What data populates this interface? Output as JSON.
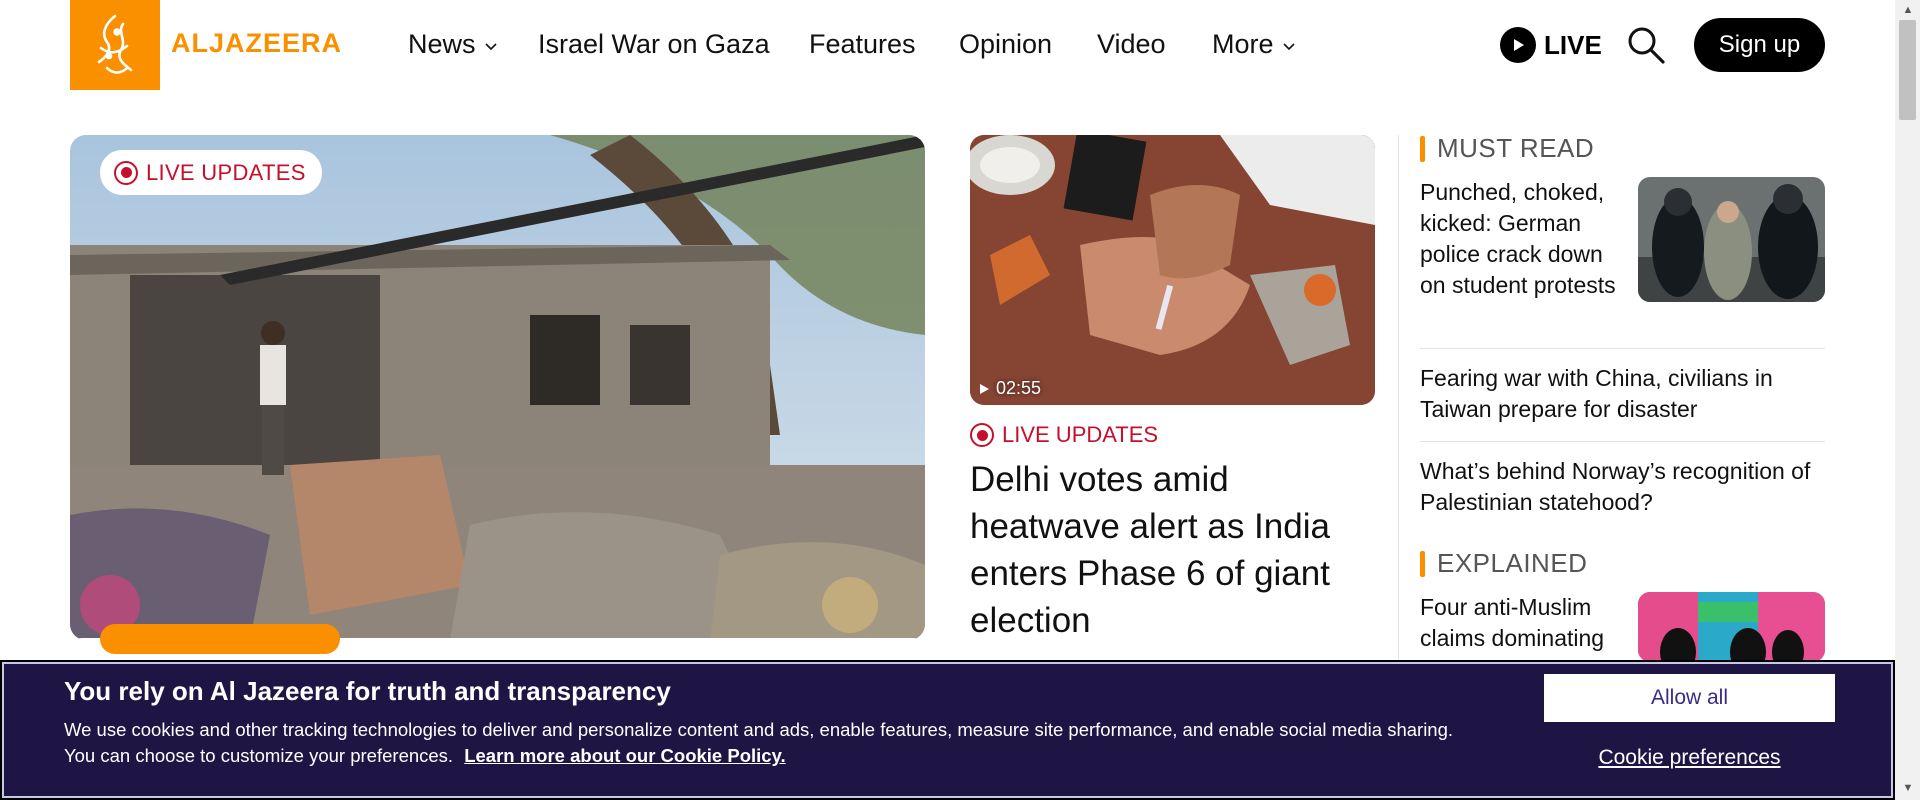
{
  "brand": {
    "name": "ALJAZEERA",
    "colors": {
      "accent": "#fa9000",
      "live_red": "#c4102c",
      "banner_bg": "#1f1545"
    }
  },
  "nav": {
    "items": [
      {
        "label": "News",
        "has_dropdown": true
      },
      {
        "label": "Israel War on Gaza",
        "has_dropdown": false
      },
      {
        "label": "Features",
        "has_dropdown": false
      },
      {
        "label": "Opinion",
        "has_dropdown": false
      },
      {
        "label": "Video",
        "has_dropdown": false
      },
      {
        "label": "More",
        "has_dropdown": true
      }
    ],
    "live_label": "LIVE",
    "signup_label": "Sign up"
  },
  "hero": {
    "badge": "LIVE UPDATES"
  },
  "second": {
    "duration": "02:55",
    "badge": "LIVE UPDATES",
    "headline": "Delhi votes amid heatwave alert as India enters Phase 6 of giant election"
  },
  "must_read": {
    "title": "MUST READ",
    "items": [
      "Punched, choked, kicked: German police crack down on student protests",
      "Fearing war with China, civilians in Taiwan prepare for disaster",
      "What’s behind Norway’s recognition of Palestinian statehood?"
    ]
  },
  "explained": {
    "title": "EXPLAINED",
    "items": [
      "Four anti-Muslim claims dominating"
    ]
  },
  "cookie": {
    "title": "You rely on Al Jazeera for truth and transparency",
    "text": "We use cookies and other tracking technologies to deliver and personalize content and ads, enable features, measure site performance, and enable social media sharing. You can choose to customize your preferences.",
    "link": "Learn more about our Cookie Policy.",
    "allow_all": "Allow all",
    "preferences": "Cookie preferences"
  }
}
